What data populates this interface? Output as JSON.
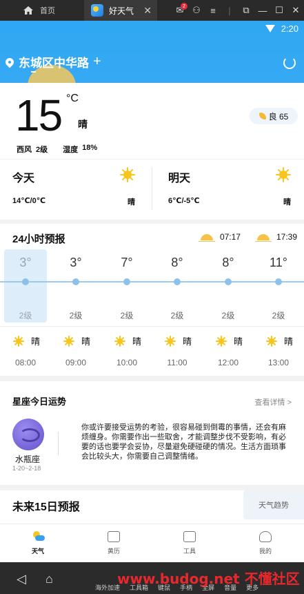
{
  "emulator": {
    "home_tab": "首页",
    "active_tab": "好天气",
    "badge": "2"
  },
  "status": {
    "time": "2:20"
  },
  "location": {
    "name": "东城区中华路",
    "add": "+"
  },
  "current": {
    "temp": "15",
    "unit": "°C",
    "condition": "晴",
    "aqi_label": "良 65",
    "wind_dir": "西风",
    "wind_level": "2级",
    "humidity_label": "湿度",
    "humidity": "18%"
  },
  "days": [
    {
      "name": "今天",
      "range": "14℃/0℃",
      "condition": "晴"
    },
    {
      "name": "明天",
      "range": "6℃/-5℃",
      "condition": "晴"
    }
  ],
  "hourly": {
    "title": "24小时预报",
    "sunrise": "07:17",
    "sunset": "17:39",
    "items": [
      {
        "temp": "3°",
        "wind": "2级",
        "cond": "晴",
        "time": "08:00"
      },
      {
        "temp": "3°",
        "wind": "2级",
        "cond": "晴",
        "time": "09:00"
      },
      {
        "temp": "7°",
        "wind": "2级",
        "cond": "晴",
        "time": "10:00"
      },
      {
        "temp": "8°",
        "wind": "2级",
        "cond": "晴",
        "time": "11:00"
      },
      {
        "temp": "8°",
        "wind": "2级",
        "cond": "晴",
        "time": "12:00"
      },
      {
        "temp": "11°",
        "wind": "2级",
        "cond": "晴",
        "time": "13:00"
      }
    ]
  },
  "horoscope": {
    "title": "星座今日运势",
    "more": "查看详情 >",
    "sign": "水瓶座",
    "dates": "1-20~2-18",
    "text": "你或许要接受运势的考验，很容易碰到倒霉的事情，还会有麻烦缠身。你需要作出一些取舍，才能调整步伐不受影响，有必要的话也要学会妥协，尽量避免硬碰硬的情况。生活方面琐事会比较头大，你需要自己调整情绪。"
  },
  "forecast15": {
    "title": "未来15日预报",
    "trend": "天气趋势"
  },
  "bottom_nav": [
    {
      "label": "天气"
    },
    {
      "label": "黄历"
    },
    {
      "label": "工具"
    },
    {
      "label": "我的"
    }
  ],
  "android_bar": {
    "tools": [
      "海外加速",
      "工具箱",
      "键鼠",
      "手柄",
      "全屏",
      "音量",
      "更多"
    ],
    "watermark": "www.budog.net 不懂社区"
  }
}
